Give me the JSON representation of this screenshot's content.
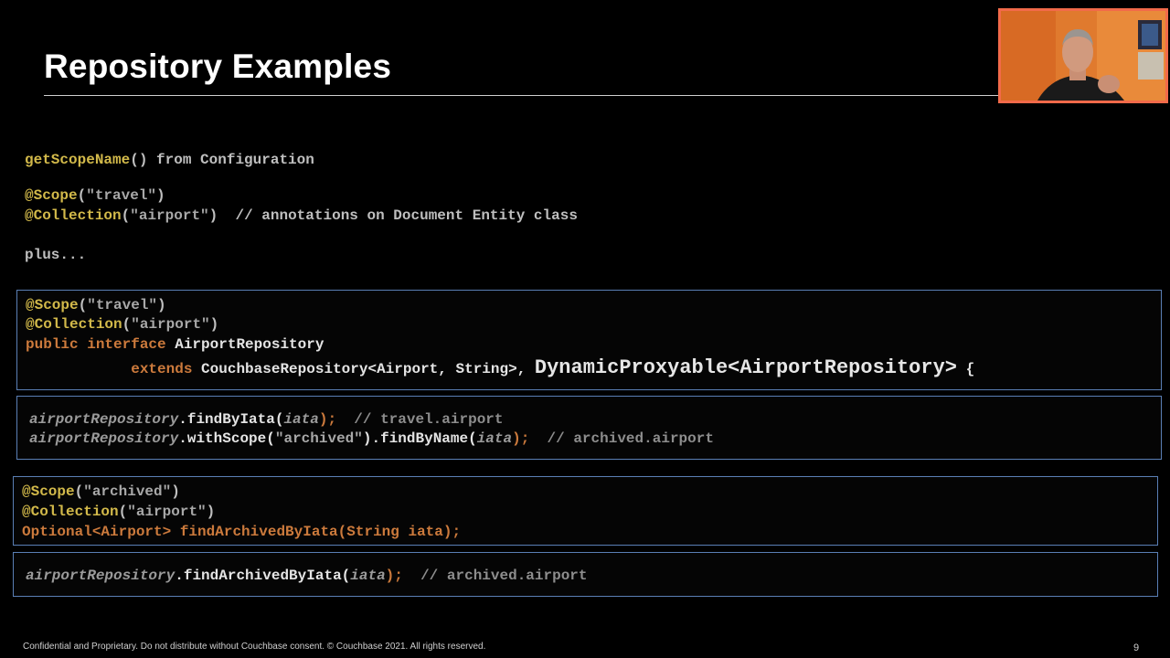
{
  "slide": {
    "title": "Repository Examples",
    "page_number": "9"
  },
  "footer": {
    "text": "Confidential and Proprietary. Do not distribute without Couchbase consent. © Couchbase 2021. All rights reserved."
  },
  "intro": {
    "line1": {
      "method": "getScopeName",
      "parens": "()",
      "rest": " from Configuration"
    },
    "line2": {
      "ann": "@Scope",
      "open": "(",
      "str": "\"travel\"",
      "close": ")"
    },
    "line3": {
      "ann": "@Collection",
      "open": "(",
      "str": "\"airport\"",
      "close": ")",
      "comment": "  // annotations on Document Entity class"
    },
    "line4": "plus..."
  },
  "box1": {
    "line1": {
      "ann": "@Scope",
      "open": "(",
      "str": "\"travel\"",
      "close": ")"
    },
    "line2": {
      "ann": "@Collection",
      "open": "(",
      "str": "\"airport\"",
      "close": ")"
    },
    "line3": {
      "kw": "public interface",
      "name": " AirportRepository"
    },
    "line4": {
      "indent": "            ",
      "kw": "extends",
      "type": " CouchbaseRepository<Airport, String>, ",
      "big": "DynamicProxyable<AirportRepository>",
      "brace": " {"
    }
  },
  "box2": {
    "line1": {
      "obj": "airportRepository",
      "call": ".findByIata(",
      "arg": "iata",
      "end": ");",
      "comment": "  // travel.airport"
    },
    "line2": {
      "obj": "airportRepository",
      "call1": ".withScope(",
      "str": "\"archived\"",
      "call2": ").findByName(",
      "arg": "iata",
      "end": ");",
      "comment": "  // archived.airport"
    }
  },
  "box3": {
    "line1": {
      "ann": "@Scope",
      "open": "(",
      "str": "\"archived\"",
      "close": ")"
    },
    "line2": {
      "ann": "@Collection",
      "open": "(",
      "str": "\"airport\"",
      "close": ")"
    },
    "line3": "Optional<Airport> findArchivedByIata(String iata);"
  },
  "box4": {
    "line1": {
      "obj": "airportRepository",
      "call": ".findArchivedByIata(",
      "arg": "iata",
      "end": ");",
      "comment": "  // archived.airport"
    }
  },
  "webcam": {
    "border_color": "#f26a4a",
    "icon": "presenter-video"
  }
}
